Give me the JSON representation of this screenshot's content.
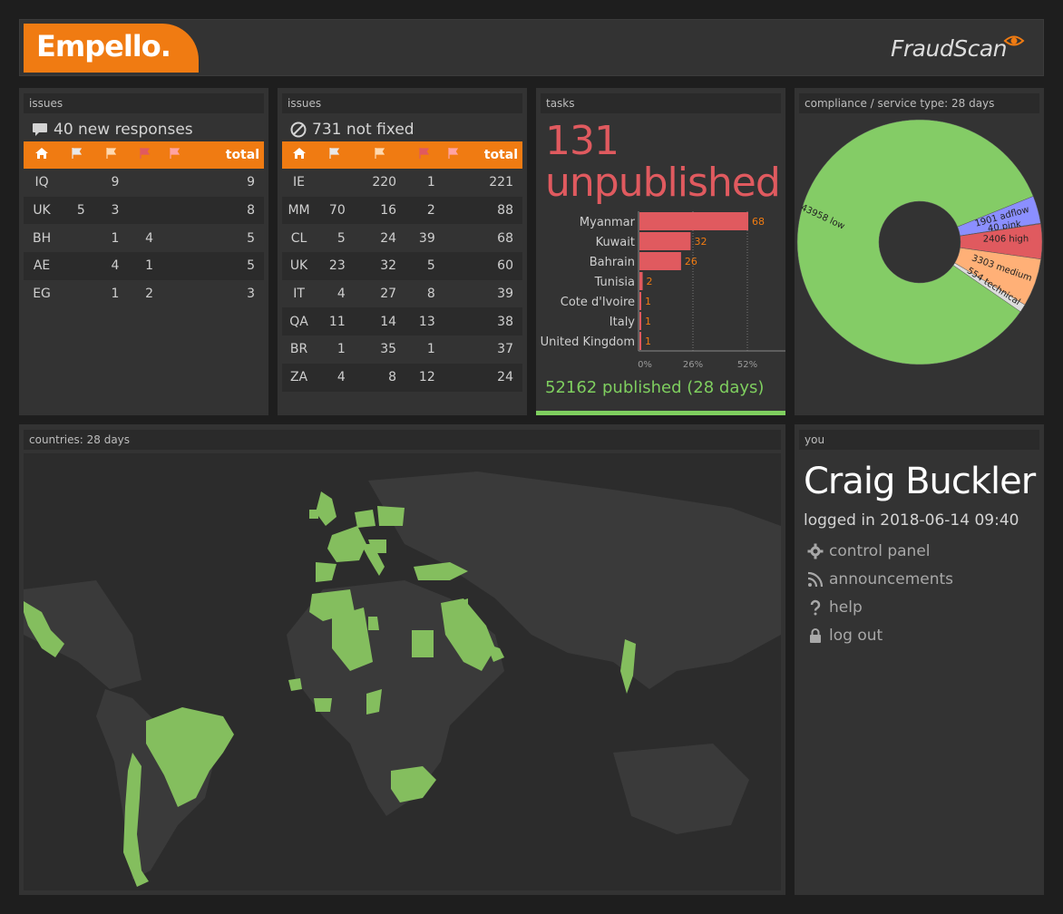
{
  "header": {
    "logo_text": "Empello.",
    "product_name": "FraudScan"
  },
  "panel_issues_responses": {
    "title": "issues",
    "summary": "40 new responses",
    "total_label": "total",
    "rows": [
      {
        "country": "IQ",
        "c1": "",
        "c2": "9",
        "c3": "",
        "c4": "",
        "total": "9"
      },
      {
        "country": "UK",
        "c1": "5",
        "c2": "3",
        "c3": "",
        "c4": "",
        "total": "8"
      },
      {
        "country": "BH",
        "c1": "",
        "c2": "1",
        "c3": "4",
        "c4": "",
        "total": "5"
      },
      {
        "country": "AE",
        "c1": "",
        "c2": "4",
        "c3": "1",
        "c4": "",
        "total": "5"
      },
      {
        "country": "EG",
        "c1": "",
        "c2": "1",
        "c3": "2",
        "c4": "",
        "total": "3"
      }
    ]
  },
  "panel_issues_notfixed": {
    "title": "issues",
    "summary": "731 not fixed",
    "total_label": "total",
    "rows": [
      {
        "country": "IE",
        "c1": "",
        "c2": "220",
        "c3": "1",
        "c4": "",
        "total": "221"
      },
      {
        "country": "MM",
        "c1": "70",
        "c2": "16",
        "c3": "2",
        "c4": "",
        "total": "88"
      },
      {
        "country": "CL",
        "c1": "5",
        "c2": "24",
        "c3": "39",
        "c4": "",
        "total": "68"
      },
      {
        "country": "UK",
        "c1": "23",
        "c2": "32",
        "c3": "5",
        "c4": "",
        "total": "60"
      },
      {
        "country": "IT",
        "c1": "4",
        "c2": "27",
        "c3": "8",
        "c4": "",
        "total": "39"
      },
      {
        "country": "QA",
        "c1": "11",
        "c2": "14",
        "c3": "13",
        "c4": "",
        "total": "38"
      },
      {
        "country": "BR",
        "c1": "1",
        "c2": "35",
        "c3": "1",
        "c4": "",
        "total": "37"
      },
      {
        "country": "ZA",
        "c1": "4",
        "c2": "8",
        "c3": "12",
        "c4": "",
        "total": "24"
      }
    ]
  },
  "panel_tasks": {
    "title": "tasks",
    "count": "131",
    "count_label": "unpublished",
    "published": "52162 published (28 days)"
  },
  "panel_compliance": {
    "title": "compliance / service type: 28 days"
  },
  "panel_countries": {
    "title": "countries: 28 days"
  },
  "panel_you": {
    "title": "you",
    "name": "Craig Buckler",
    "logged_in": "logged in 2018-06-14 09:40",
    "menu": [
      {
        "label": "control panel",
        "icon": "gear-icon"
      },
      {
        "label": "announcements",
        "icon": "rss-icon"
      },
      {
        "label": "help",
        "icon": "question-icon"
      },
      {
        "label": "log out",
        "icon": "lock-icon"
      }
    ]
  },
  "colors": {
    "orange": "#f07b12",
    "red": "#e05a5f",
    "green": "#7fcf5f",
    "blue": "#8b8fff",
    "pink": "#ff99cc",
    "peach": "#ffb077"
  },
  "chart_data": [
    {
      "type": "bar",
      "orientation": "horizontal",
      "categories": [
        "Myanmar",
        "Kuwait",
        "Bahrain",
        "Tunisia",
        "Cote d'Ivoire",
        "Italy",
        "United Kingdom"
      ],
      "values": [
        68,
        32,
        26,
        2,
        1,
        1,
        1
      ],
      "xticks": [
        "0%",
        "26%",
        "52%"
      ],
      "xlim": [
        0,
        68
      ]
    },
    {
      "type": "pie",
      "donut": true,
      "slices": [
        {
          "label": "low",
          "value": 43958,
          "color": "#84cc66"
        },
        {
          "label": "adflow",
          "value": 1901,
          "color": "#8b8fff"
        },
        {
          "label": "pink",
          "value": 40,
          "color": "#ff99cc"
        },
        {
          "label": "high",
          "value": 2406,
          "color": "#e05a5f"
        },
        {
          "label": "medium",
          "value": 3303,
          "color": "#ffb077"
        },
        {
          "label": "technical",
          "value": 554,
          "color": "#dddddd"
        }
      ]
    }
  ]
}
